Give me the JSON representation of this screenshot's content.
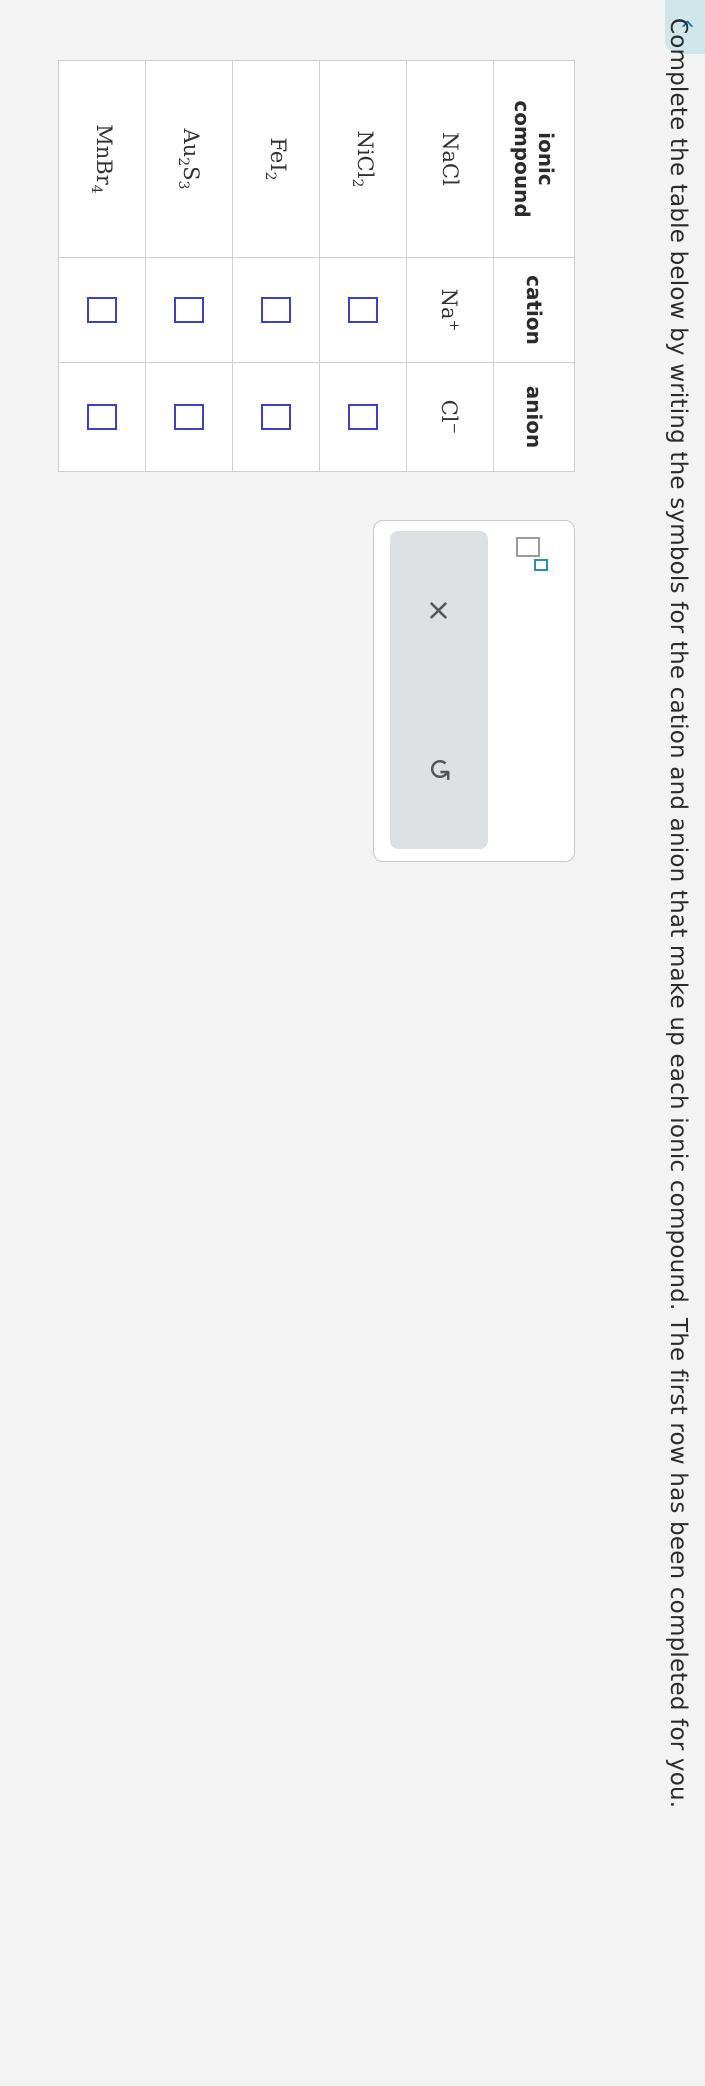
{
  "question_text": "Complete the table below by writing the symbols for the cation and anion that make up each ionic compound. The first row has been completed for you.",
  "collapse_chevron": "‹",
  "table": {
    "headers": {
      "compound_line1": "ionic",
      "compound_line2": "compound",
      "cation": "cation",
      "anion": "anion"
    },
    "rows": [
      {
        "compound_base": "NaCl",
        "cation_base": "Na",
        "cation_sup": "+",
        "anion_base": "Cl",
        "anion_sup": "−"
      },
      {
        "compound_base": "NiCl",
        "compound_sub": "2"
      },
      {
        "compound_base": "FeI",
        "compound_sub": "2"
      },
      {
        "compound_a": "Au",
        "compound_a_sub": "2",
        "compound_b": "S",
        "compound_b_sub": "3"
      },
      {
        "compound_base": "MnBr",
        "compound_sub": "4"
      }
    ]
  },
  "panel": {
    "clear_symbol": "×",
    "undo_symbol": "↺"
  }
}
